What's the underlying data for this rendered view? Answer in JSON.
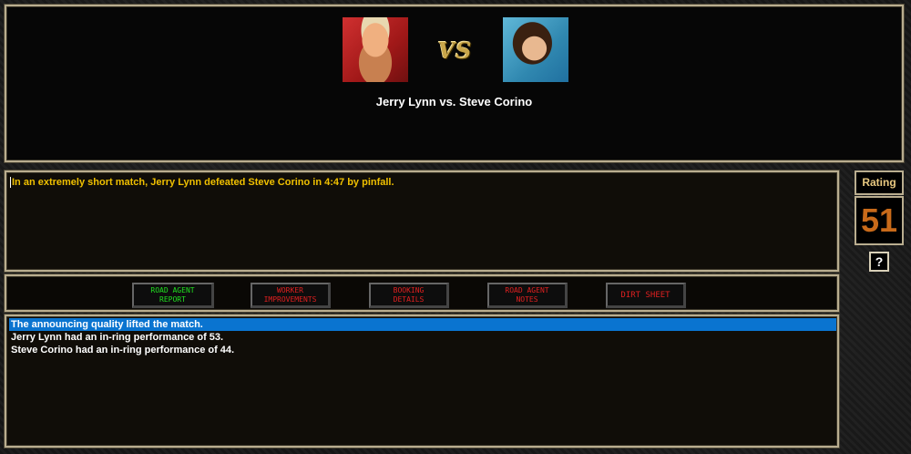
{
  "match": {
    "title": "Jerry Lynn vs. Steve Corino",
    "vs_label": "VS",
    "left_photo_icon": "wrestler-photo",
    "right_photo_icon": "wrestler-photo"
  },
  "result": {
    "text": "In an extremely short match, Jerry Lynn defeated Steve Corino in 4:47 by pinfall."
  },
  "buttons": [
    {
      "label": "ROAD AGENT\nREPORT",
      "color": "#20e020"
    },
    {
      "label": "WORKER\nIMPROVEMENTS",
      "color": "#e02020"
    },
    {
      "label": "BOOKING\nDETAILS",
      "color": "#e02020"
    },
    {
      "label": "ROAD AGENT\nNOTES",
      "color": "#e02020"
    },
    {
      "label": "DIRT SHEET",
      "color": "#e02020"
    }
  ],
  "notes": [
    {
      "text": "The announcing quality lifted the match.",
      "selected": true
    },
    {
      "text": "Jerry Lynn had an in-ring performance of 53.",
      "selected": false
    },
    {
      "text": "Steve Corino had an in-ring performance of 44.",
      "selected": false
    }
  ],
  "rating": {
    "label": "Rating",
    "value": "51",
    "help_label": "?"
  },
  "colors": {
    "highlight": "#0a74d0",
    "result_text": "#f0c000",
    "rating_value": "#c86a1a",
    "border": "#b9ad8f"
  }
}
